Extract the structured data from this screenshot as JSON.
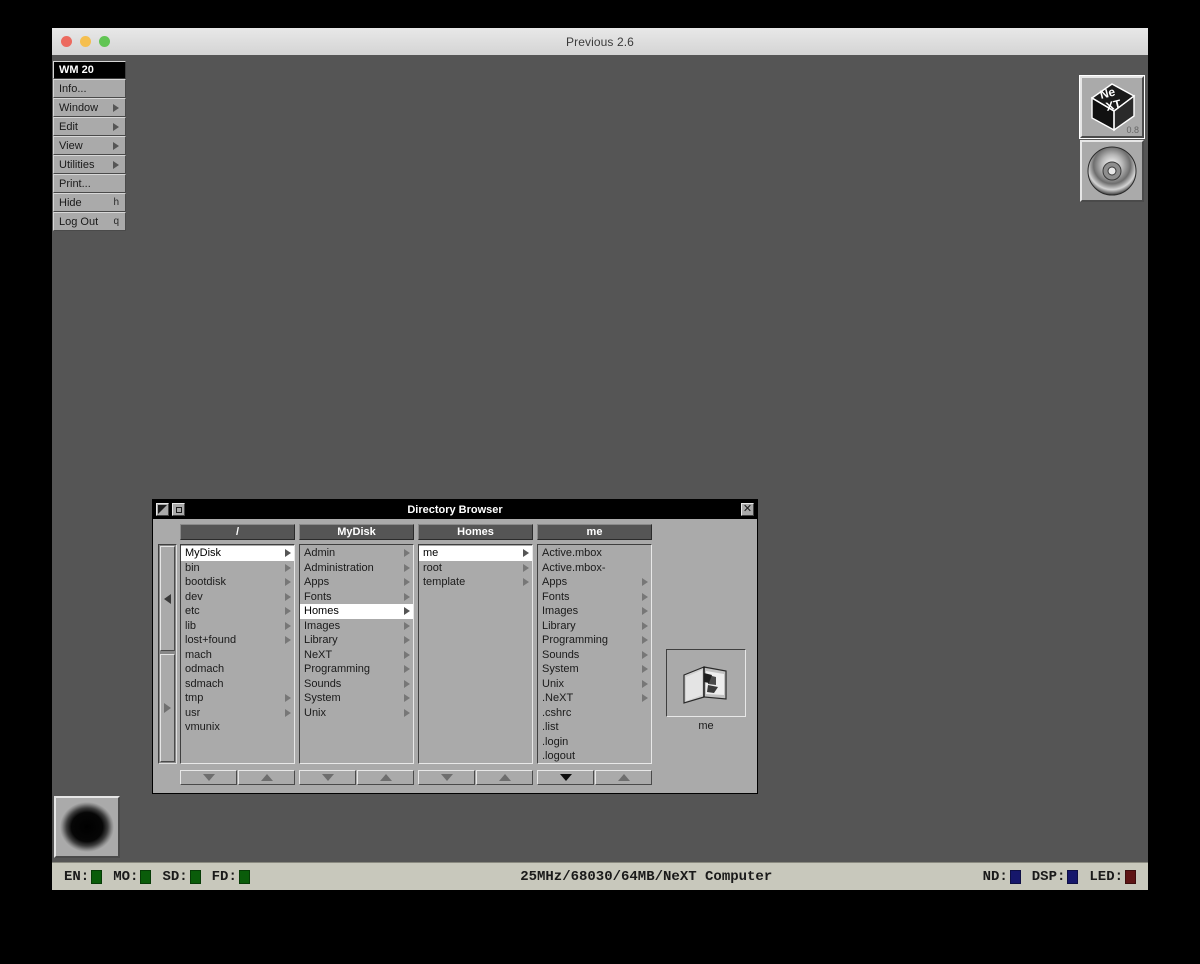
{
  "host": {
    "title": "Previous 2.6",
    "traffic_lights": [
      "close",
      "minimize",
      "zoom"
    ]
  },
  "menu": {
    "title": "WM 20",
    "items": [
      {
        "label": "Info...",
        "key": "",
        "submenu": false
      },
      {
        "label": "Window",
        "key": "",
        "submenu": true
      },
      {
        "label": "Edit",
        "key": "",
        "submenu": true
      },
      {
        "label": "View",
        "key": "",
        "submenu": true
      },
      {
        "label": "Utilities",
        "key": "",
        "submenu": true
      },
      {
        "label": "Print...",
        "key": "",
        "submenu": false
      },
      {
        "label": "Hide",
        "key": "h",
        "submenu": false
      },
      {
        "label": "Log Out",
        "key": "q",
        "submenu": false
      }
    ]
  },
  "dock": {
    "items": [
      {
        "name": "next-cube-icon",
        "version": "0.8"
      },
      {
        "name": "optical-disc-icon",
        "version": ""
      }
    ]
  },
  "recycler": {
    "label": "recycler"
  },
  "browser": {
    "title": "Directory Browser",
    "close_glyph": "✕",
    "columns": [
      {
        "header": "/",
        "items": [
          {
            "name": "MyDisk",
            "branch": true,
            "selected": true
          },
          {
            "name": "bin",
            "branch": true,
            "selected": false
          },
          {
            "name": "bootdisk",
            "branch": true,
            "selected": false
          },
          {
            "name": "dev",
            "branch": true,
            "selected": false
          },
          {
            "name": "etc",
            "branch": true,
            "selected": false
          },
          {
            "name": "lib",
            "branch": true,
            "selected": false
          },
          {
            "name": "lost+found",
            "branch": true,
            "selected": false
          },
          {
            "name": "mach",
            "branch": false,
            "selected": false
          },
          {
            "name": "odmach",
            "branch": false,
            "selected": false
          },
          {
            "name": "sdmach",
            "branch": false,
            "selected": false
          },
          {
            "name": "tmp",
            "branch": true,
            "selected": false
          },
          {
            "name": "usr",
            "branch": true,
            "selected": false
          },
          {
            "name": "vmunix",
            "branch": false,
            "selected": false
          }
        ],
        "scroll_down_active": false
      },
      {
        "header": "MyDisk",
        "items": [
          {
            "name": "Admin",
            "branch": true,
            "selected": false
          },
          {
            "name": "Administration",
            "branch": true,
            "selected": false
          },
          {
            "name": "Apps",
            "branch": true,
            "selected": false
          },
          {
            "name": "Fonts",
            "branch": true,
            "selected": false
          },
          {
            "name": "Homes",
            "branch": true,
            "selected": true
          },
          {
            "name": "Images",
            "branch": true,
            "selected": false
          },
          {
            "name": "Library",
            "branch": true,
            "selected": false
          },
          {
            "name": "NeXT",
            "branch": true,
            "selected": false
          },
          {
            "name": "Programming",
            "branch": true,
            "selected": false
          },
          {
            "name": "Sounds",
            "branch": true,
            "selected": false
          },
          {
            "name": "System",
            "branch": true,
            "selected": false
          },
          {
            "name": "Unix",
            "branch": true,
            "selected": false
          }
        ],
        "scroll_down_active": false
      },
      {
        "header": "Homes",
        "items": [
          {
            "name": "me",
            "branch": true,
            "selected": true
          },
          {
            "name": "root",
            "branch": true,
            "selected": false
          },
          {
            "name": "template",
            "branch": true,
            "selected": false
          }
        ],
        "scroll_down_active": false
      },
      {
        "header": "me",
        "items": [
          {
            "name": "Active.mbox",
            "branch": false,
            "selected": false
          },
          {
            "name": "Active.mbox-",
            "branch": false,
            "selected": false
          },
          {
            "name": "Apps",
            "branch": true,
            "selected": false
          },
          {
            "name": "Fonts",
            "branch": true,
            "selected": false
          },
          {
            "name": "Images",
            "branch": true,
            "selected": false
          },
          {
            "name": "Library",
            "branch": true,
            "selected": false
          },
          {
            "name": "Programming",
            "branch": true,
            "selected": false
          },
          {
            "name": "Sounds",
            "branch": true,
            "selected": false
          },
          {
            "name": "System",
            "branch": true,
            "selected": false
          },
          {
            "name": "Unix",
            "branch": true,
            "selected": false
          },
          {
            "name": ".NeXT",
            "branch": true,
            "selected": false
          },
          {
            "name": ".cshrc",
            "branch": false,
            "selected": false
          },
          {
            "name": ".list",
            "branch": false,
            "selected": false
          },
          {
            "name": ".login",
            "branch": false,
            "selected": false
          },
          {
            "name": ".logout",
            "branch": false,
            "selected": false
          }
        ],
        "scroll_down_active": true
      }
    ],
    "preview": {
      "label": "me",
      "icon": "home-folder-icon"
    }
  },
  "statusbar": {
    "left_leds": [
      {
        "label": "EN:",
        "color": "#0a5c0a"
      },
      {
        "label": "MO:",
        "color": "#0a5c0a"
      },
      {
        "label": "SD:",
        "color": "#0a5c0a"
      },
      {
        "label": "FD:",
        "color": "#0a5c0a"
      }
    ],
    "machine": "25MHz/68030/64MB/NeXT Computer",
    "right_leds": [
      {
        "label": "ND:",
        "color": "#16176b"
      },
      {
        "label": "DSP:",
        "color": "#16176b"
      },
      {
        "label": "LED:",
        "color": "#5e1414"
      }
    ]
  }
}
